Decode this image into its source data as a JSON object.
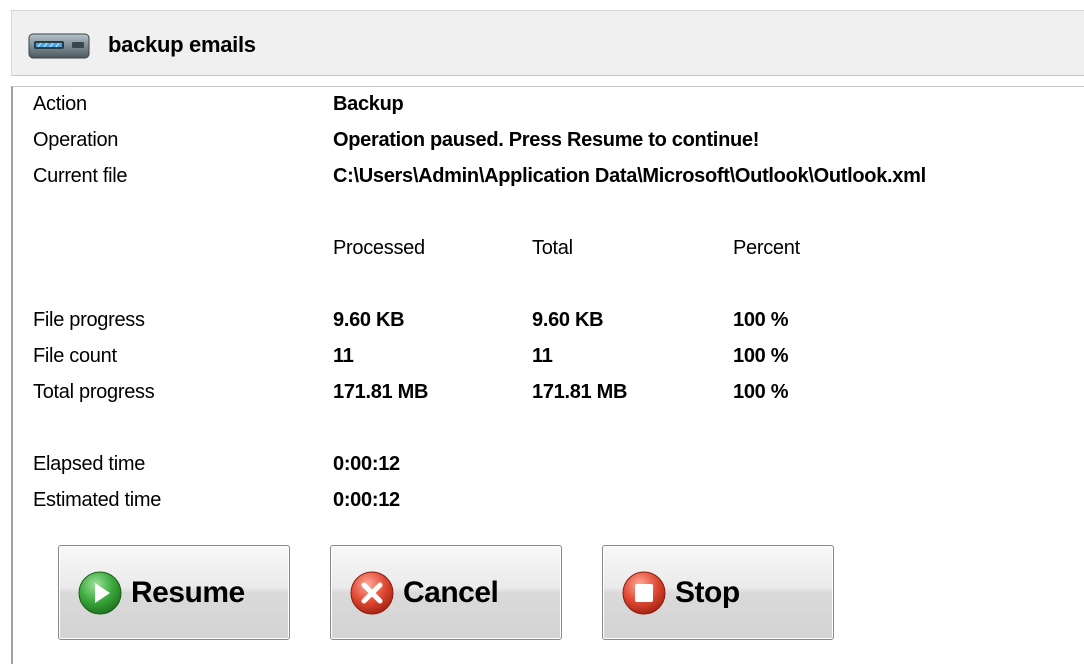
{
  "window": {
    "title": "backup emails",
    "icon": "drive-icon"
  },
  "info": {
    "action_label": "Action",
    "action_value": "Backup",
    "operation_label": "Operation",
    "operation_value": "Operation paused. Press Resume to continue!",
    "current_file_label": "Current file",
    "current_file_value": "C:\\Users\\Admin\\Application Data\\Microsoft\\Outlook\\Outlook.xml"
  },
  "progress": {
    "headers": [
      "Processed",
      "Total",
      "Percent"
    ],
    "rows": [
      {
        "label": "File progress",
        "processed": "9.60 KB",
        "total": "9.60 KB",
        "percent": "100 %"
      },
      {
        "label": "File count",
        "processed": "11",
        "total": "11",
        "percent": "100 %"
      },
      {
        "label": "Total progress",
        "processed": "171.81 MB",
        "total": "171.81 MB",
        "percent": "100 %"
      }
    ]
  },
  "time": {
    "elapsed_label": "Elapsed time",
    "elapsed_value": "0:00:12",
    "estimated_label": "Estimated time",
    "estimated_value": "0:00:12"
  },
  "buttons": {
    "resume": {
      "label": "Resume",
      "icon": "play-icon",
      "color": "#2e9e2e"
    },
    "cancel": {
      "label": "Cancel",
      "icon": "x-circle-icon",
      "color": "#d93a2a"
    },
    "stop": {
      "label": "Stop",
      "icon": "stop-icon",
      "color": "#d93a2a"
    }
  }
}
